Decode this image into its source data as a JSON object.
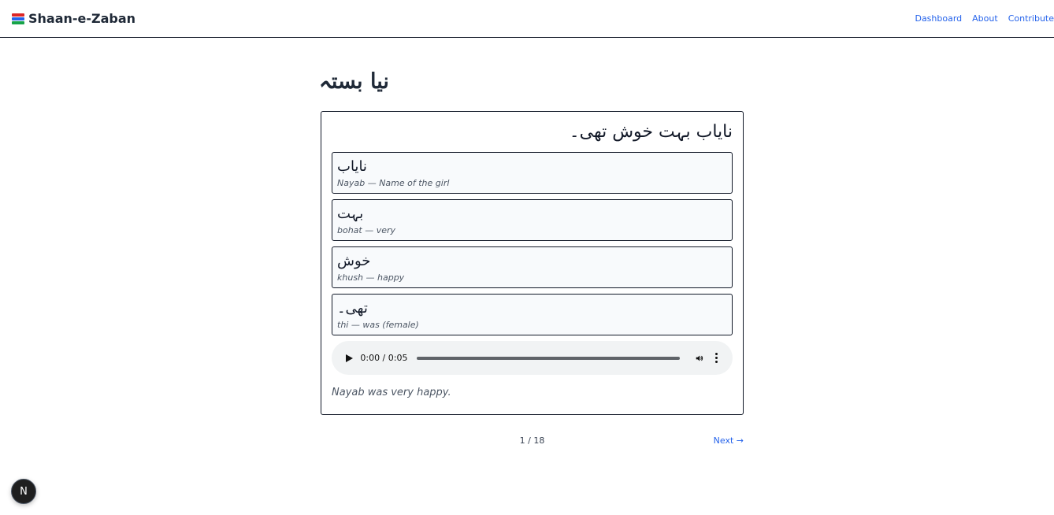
{
  "app": {
    "brand_icon": "books-icon",
    "brand_name": "Shaan-e-Zaban"
  },
  "nav": {
    "links": [
      "Dashboard",
      "About",
      "Contribute"
    ],
    "link_color": "#2563eb"
  },
  "lesson": {
    "title": "نیا بستہ",
    "sentence": "نایاب بہت خوش تھی۔",
    "words": [
      {
        "urdu": "نایاب",
        "gloss": "Nayab — Name of the girl"
      },
      {
        "urdu": "بہت",
        "gloss": "bohat — very"
      },
      {
        "urdu": "خوش",
        "gloss": "khush — happy"
      },
      {
        "urdu": "تھی۔",
        "gloss": "thi — was (female)"
      }
    ],
    "audio": {
      "time": "0:00 / 0:05",
      "progress": 0
    },
    "translation": "Nayab was very happy."
  },
  "pager": {
    "count": "1 / 18",
    "next_label": "Next →"
  },
  "dev_badge": {
    "label": "N"
  }
}
